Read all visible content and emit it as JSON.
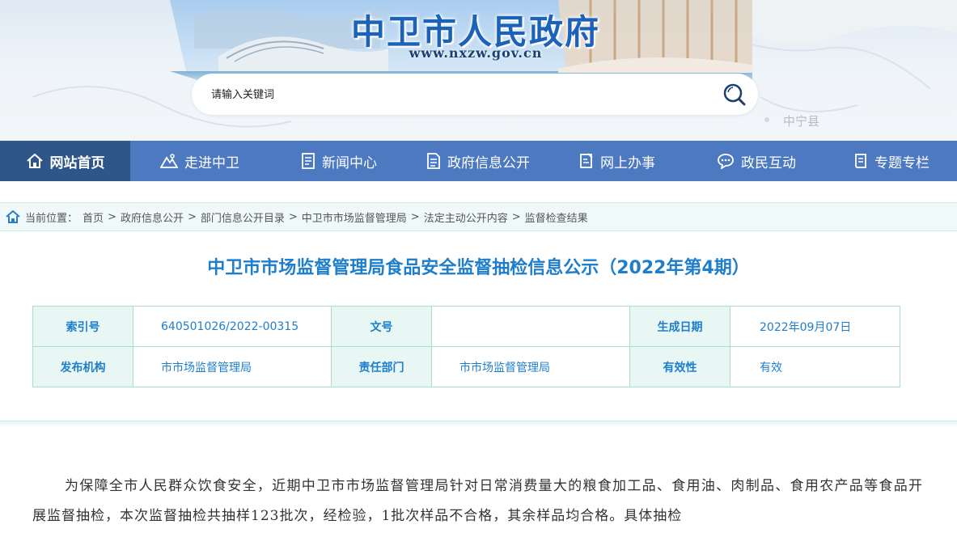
{
  "header": {
    "site_title": "中卫市人民政府",
    "site_url": "www.nxzw.gov.cn",
    "map_label": "中宁县"
  },
  "search": {
    "placeholder": "请输入关键词",
    "icon": "search-icon"
  },
  "nav": {
    "items": [
      {
        "label": "网站首页",
        "icon": "home-icon"
      },
      {
        "label": "走进中卫",
        "icon": "mountain-icon"
      },
      {
        "label": "新闻中心",
        "icon": "document-icon"
      },
      {
        "label": "政府信息公开",
        "icon": "list-document-icon"
      },
      {
        "label": "网上办事",
        "icon": "edit-document-icon"
      },
      {
        "label": "政民互动",
        "icon": "chat-icon"
      },
      {
        "label": "专题专栏",
        "icon": "book-icon"
      }
    ]
  },
  "breadcrumb": {
    "prefix": "当前位置：",
    "items": [
      "首页",
      "政府信息公开",
      "部门信息公开目录",
      "中卫市市场监督管理局",
      "法定主动公开内容",
      "监督检查结果"
    ]
  },
  "document": {
    "title": "中卫市市场监督管理局食品安全监督抽检信息公示（2022年第4期）",
    "meta": {
      "index_label": "索引号",
      "index_value": "640501026/2022-00315",
      "docno_label": "文号",
      "docno_value": "",
      "date_label": "生成日期",
      "date_value": "2022年09月07日",
      "publisher_label": "发布机构",
      "publisher_value": "市市场监督管理局",
      "dept_label": "责任部门",
      "dept_value": "市市场监督管理局",
      "validity_label": "有效性",
      "validity_value": "有效"
    },
    "body": "为保障全市人民群众饮食安全，近期中卫市市场监督管理局针对日常消费量大的粮食加工品、食用油、肉制品、食用农产品等食品开展监督抽检，本次监督抽检共抽样123批次，经检验，1批次样品不合格，其余样品均合格。具体抽检"
  },
  "colors": {
    "nav_bg": "#4d79c1",
    "nav_active": "#2e5689",
    "title_blue": "#1e7ecb",
    "table_border": "#a9ddd1",
    "table_key_bg": "#e8f7f4"
  }
}
